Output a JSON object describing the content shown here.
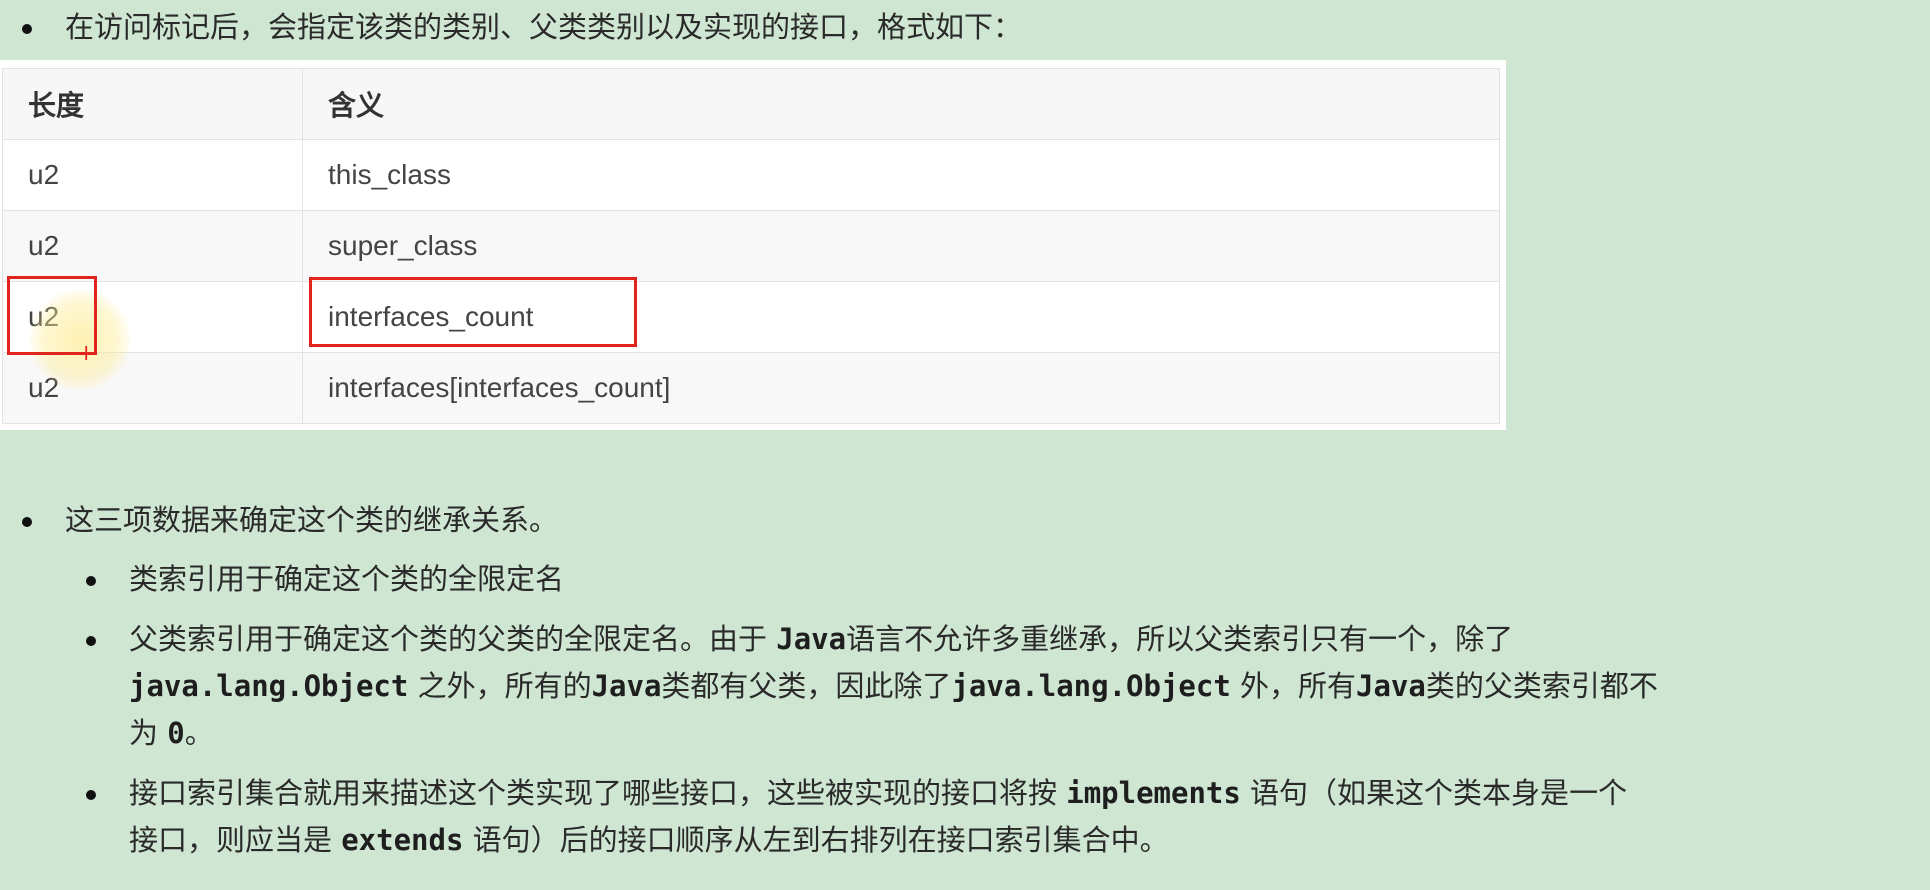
{
  "intro": {
    "text": "在访问标记后，会指定该类的类别、父类类别以及实现的接口，格式如下："
  },
  "table": {
    "headers": [
      "长度",
      "含义"
    ],
    "rows": [
      [
        "u2",
        "this_class"
      ],
      [
        "u2",
        "super_class"
      ],
      [
        "u2",
        "interfaces_count"
      ],
      [
        "u2",
        "interfaces[interfaces_count]"
      ]
    ]
  },
  "notes": {
    "main": "这三项数据来确定这个类的继承关系。",
    "sub1": "类索引用于确定这个类的全限定名",
    "sub2": {
      "p1": "父类索引用于确定这个类的父类的全限定名。由于 ",
      "c1": "Java",
      "p2": "语言不允许多重继承，所以父类索引只有一个，除了",
      "c2": "java.lang.Object",
      "p3": " 之外，所有的",
      "c3": "Java",
      "p4": "类都有父类，因此除了",
      "c4": "java.lang.Object",
      "p5": " 外，所有",
      "c5": "Java",
      "p6": "类的父类索引都不",
      "p7": "为 ",
      "c6": "0",
      "p8": "。"
    },
    "sub3": {
      "p1": "接口索引集合就用来描述这个类实现了哪些接口，这些被实现的接口将按 ",
      "c1": "implements",
      "p2": " 语句（如果这个类本身是一个",
      "p3": "接口，则应当是 ",
      "c2": "extends",
      "p4": " 语句）后的接口顺序从左到右排列在接口索引集合中。"
    }
  },
  "highlight_color": "#e0251f"
}
